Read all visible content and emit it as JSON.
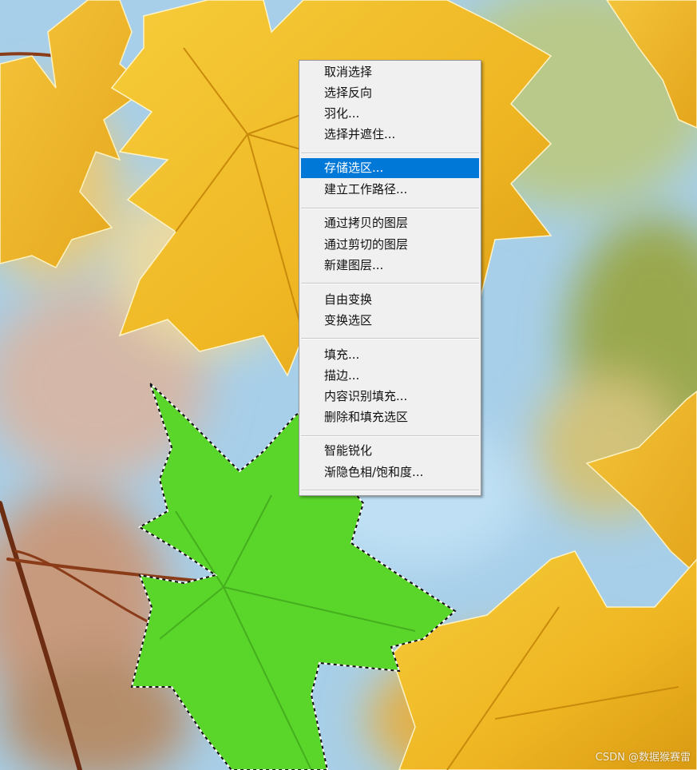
{
  "menu": {
    "items": [
      {
        "label": "取消选择"
      },
      {
        "label": "选择反向"
      },
      {
        "label": "羽化..."
      },
      {
        "label": "选择并遮住..."
      },
      {
        "label": "存储选区...",
        "highlighted": true
      },
      {
        "label": "建立工作路径..."
      },
      {
        "label": "通过拷贝的图层"
      },
      {
        "label": "通过剪切的图层"
      },
      {
        "label": "新建图层..."
      },
      {
        "label": "自由变换"
      },
      {
        "label": "变换选区"
      },
      {
        "label": "填充..."
      },
      {
        "label": "描边..."
      },
      {
        "label": "内容识别填充..."
      },
      {
        "label": "删除和填充选区"
      },
      {
        "label": "智能锐化"
      },
      {
        "label": "渐隐色相/饱和度..."
      }
    ],
    "highlight_color": "#0078d7"
  },
  "canvas": {
    "selected_leaf_color": "#5ad62a",
    "leaf_color": "#f2bd2a",
    "sky_color": "#a9d2ee"
  },
  "watermark": "CSDN @数据猴赛雷"
}
